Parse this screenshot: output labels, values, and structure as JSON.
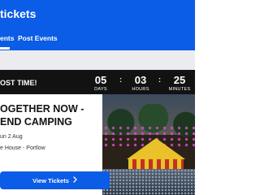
{
  "header": {
    "title": "tickets"
  },
  "tabs": [
    {
      "label": "ents",
      "active": true
    },
    {
      "label": "Post Events",
      "active": false
    }
  ],
  "banner": {
    "text": "OST TIME!"
  },
  "countdown": {
    "days": {
      "value": "05",
      "label": "DAYS"
    },
    "hours": {
      "value": "03",
      "label": "HOURS"
    },
    "minutes": {
      "value": "25",
      "label": "MINUTES"
    },
    "separator": ":"
  },
  "event": {
    "title_line1": "OGETHER NOW -",
    "title_line2": "END CAMPING",
    "date": "un 2 Aug",
    "venue": "e House - Portlow"
  },
  "button": {
    "label": "View Tickets",
    "icon": "chevron-right-icon"
  },
  "colors": {
    "brand": "#0b5ce6",
    "banner": "#121212",
    "background": "#ececf0"
  }
}
